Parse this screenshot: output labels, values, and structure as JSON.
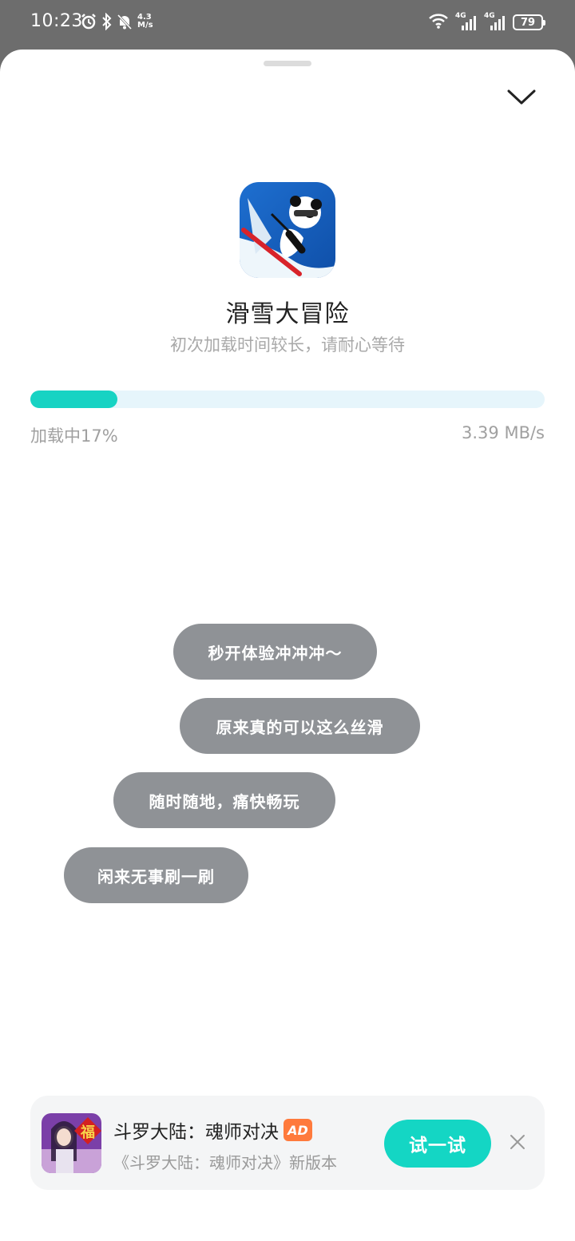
{
  "status_bar": {
    "time": "10:23",
    "net_speed_value": "4.3",
    "net_speed_unit": "M/s",
    "net1": "4G",
    "net2": "4G",
    "battery": "79"
  },
  "app": {
    "title": "滑雪大冒险",
    "subtitle": "初次加载时间较长，请耐心等待"
  },
  "progress": {
    "label": "加载中17%",
    "percent": 17,
    "speed": "3.39 MB/s"
  },
  "bubbles": [
    "秒开体验冲冲冲～",
    "原来真的可以这么丝滑",
    "随时随地，痛快畅玩",
    "闲来无事刷一刷"
  ],
  "ad": {
    "title": "斗罗大陆：魂师对决",
    "badge": "AD",
    "description": "《斗罗大陆：魂师对决》新版本",
    "cta": "试一试",
    "thumb_glyph": "福"
  },
  "colors": {
    "accent": "#17d3c3",
    "track": "#e6f5fb",
    "bubble": "#8f9296",
    "ad_badge": "#ff7a3c"
  }
}
